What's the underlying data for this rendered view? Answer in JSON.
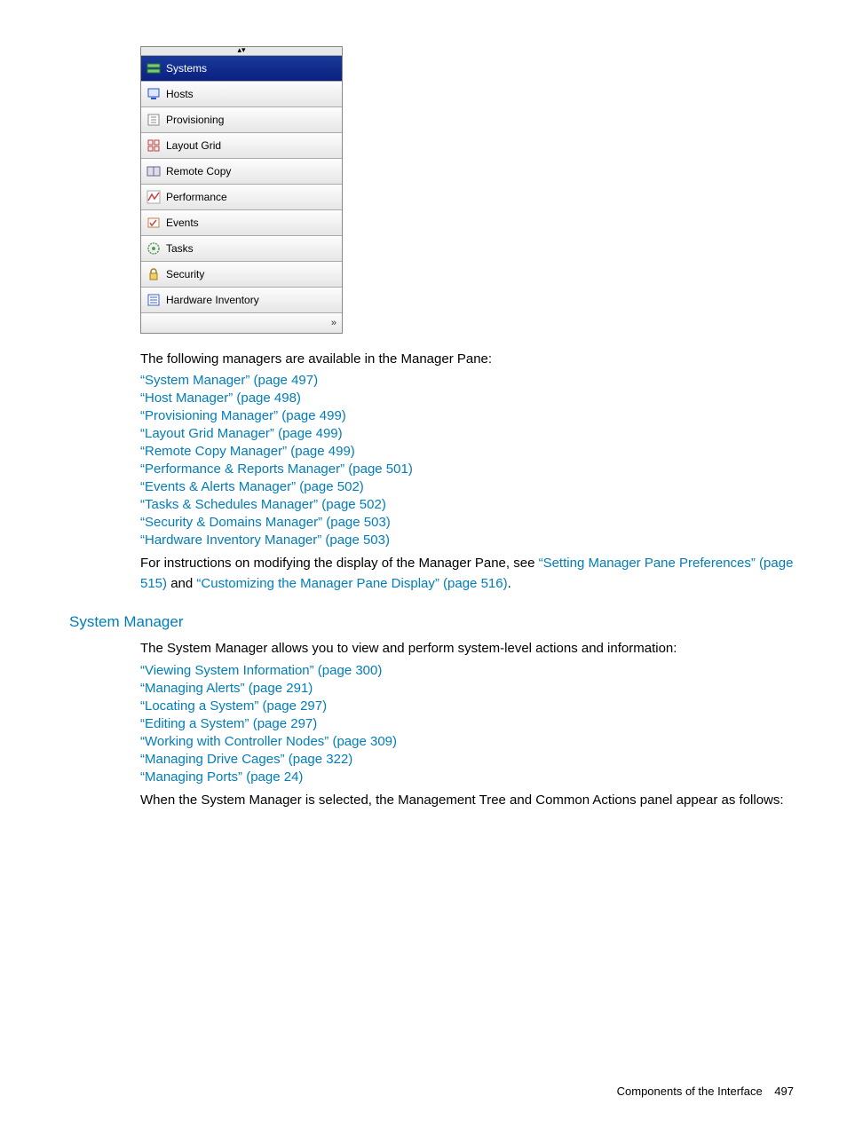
{
  "pane": {
    "items": [
      {
        "label": "Systems",
        "selected": true
      },
      {
        "label": "Hosts",
        "selected": false
      },
      {
        "label": "Provisioning",
        "selected": false
      },
      {
        "label": "Layout Grid",
        "selected": false
      },
      {
        "label": "Remote Copy",
        "selected": false
      },
      {
        "label": "Performance",
        "selected": false
      },
      {
        "label": "Events",
        "selected": false
      },
      {
        "label": "Tasks",
        "selected": false
      },
      {
        "label": "Security",
        "selected": false
      },
      {
        "label": "Hardware Inventory",
        "selected": false
      }
    ]
  },
  "intro": "The following managers are available in the Manager Pane:",
  "mgrLinks": [
    "“System Manager” (page 497)",
    "“Host Manager” (page 498)",
    "“Provisioning Manager” (page 499)",
    "“Layout Grid Manager” (page 499)",
    "“Remote Copy Manager” (page 499)",
    "“Performance & Reports Manager” (page 501)",
    "“Events & Alerts Manager” (page 502)",
    "“Tasks & Schedules Manager” (page 502)",
    "“Security & Domains Manager” (page 503)",
    "“Hardware Inventory Manager” (page 503)"
  ],
  "afterLinks": {
    "pre": "For instructions on modifying the display of the Manager Pane, see ",
    "link1": "“Setting Manager Pane Preferences” (page 515)",
    "mid": " and ",
    "link2": "“Customizing the Manager Pane Display” (page 516)",
    "end": "."
  },
  "sectionHeading": "System Manager",
  "sectionIntro": "The System Manager allows you to view and perform system-level actions and information:",
  "smLinks": [
    "“Viewing System Information” (page 300)",
    "“Managing Alerts” (page 291)",
    "“Locating a System” (page 297)",
    "“Editing a System” (page 297)",
    "“Working with Controller Nodes” (page 309)",
    "“Managing Drive Cages” (page 322)",
    "“Managing Ports” (page 24)"
  ],
  "smOutro": "When the System Manager is selected, the Management Tree and Common Actions panel appear as follows:",
  "footer": {
    "label": "Components of the Interface",
    "page": "497"
  }
}
